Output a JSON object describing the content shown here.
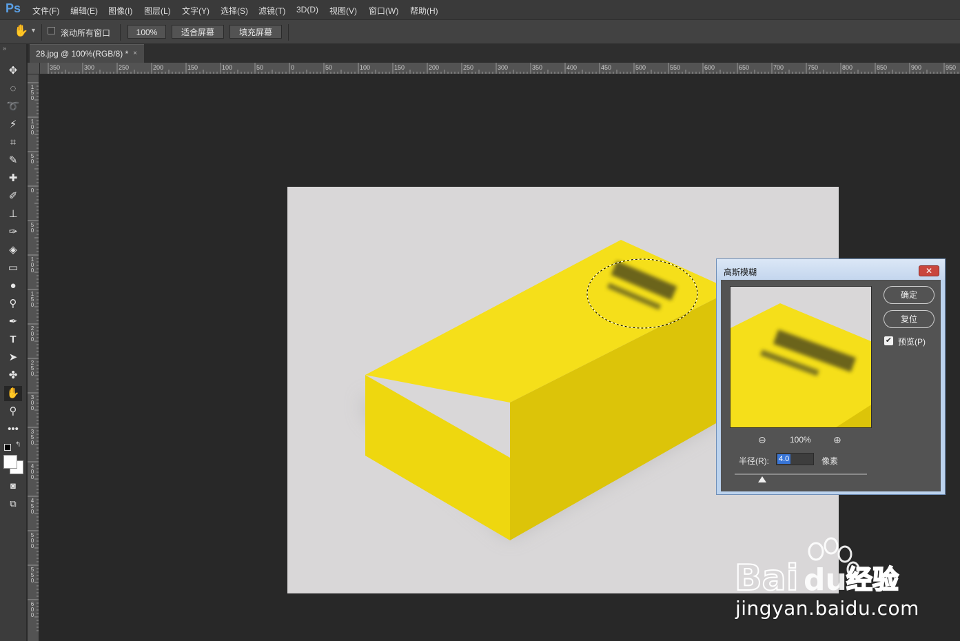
{
  "app": {
    "logo": "Ps"
  },
  "menu": [
    "文件(F)",
    "编辑(E)",
    "图像(I)",
    "图层(L)",
    "文字(Y)",
    "选择(S)",
    "滤镜(T)",
    "3D(D)",
    "视图(V)",
    "窗口(W)",
    "帮助(H)"
  ],
  "options": {
    "tool_icon": "hand-icon",
    "scroll_all_label": "滚动所有窗口",
    "scroll_all_checked": false,
    "zoom_100": "100%",
    "fit_screen": "适合屏幕",
    "fill_screen": "填充屏幕"
  },
  "tools": [
    "move-icon",
    "ellipse-marquee-icon",
    "lasso-icon",
    "magic-wand-icon",
    "crop-icon",
    "eyedropper-icon",
    "healing-brush-icon",
    "brush-icon",
    "clone-stamp-icon",
    "history-brush-icon",
    "eraser-icon",
    "gradient-icon",
    "blur-icon",
    "dodge-icon",
    "pen-icon",
    "type-icon",
    "path-selection-icon",
    "custom-shape-icon",
    "hand-icon",
    "zoom-icon",
    "more-tools-icon"
  ],
  "active_tool": "hand-icon",
  "document": {
    "tab_title": "28.jpg @ 100%(RGB/8) *",
    "close": "×"
  },
  "rulers": {
    "horizontal": [
      "350",
      "300",
      "250",
      "200",
      "150",
      "100",
      "50",
      "0",
      "50",
      "100",
      "150",
      "200",
      "250",
      "300",
      "350",
      "400",
      "450",
      "500",
      "550",
      "600",
      "650",
      "700",
      "750",
      "800",
      "850",
      "900",
      "950"
    ],
    "vertical": [
      "150",
      "100",
      "50",
      "0",
      "50",
      "100",
      "150",
      "200",
      "250",
      "300",
      "350",
      "400",
      "450",
      "500",
      "550",
      "600"
    ]
  },
  "dialog": {
    "title": "高斯模糊",
    "close": "✕",
    "ok": "确定",
    "reset": "复位",
    "preview_label": "预览(P)",
    "preview_checked": true,
    "zoom_level": "100%",
    "radius_label": "半径(R):",
    "radius_value": "4.0",
    "radius_unit": "像素"
  },
  "watermark": {
    "brand": "Bai",
    "brand2": "du",
    "suffix": "经验",
    "url": "jingyan.baidu.com"
  },
  "colors": {
    "box_top": "#f5df1a",
    "box_left": "#eed70f",
    "box_right": "#dcc409",
    "canvas_bg": "#d9d7d8",
    "workspace": "#282828"
  }
}
